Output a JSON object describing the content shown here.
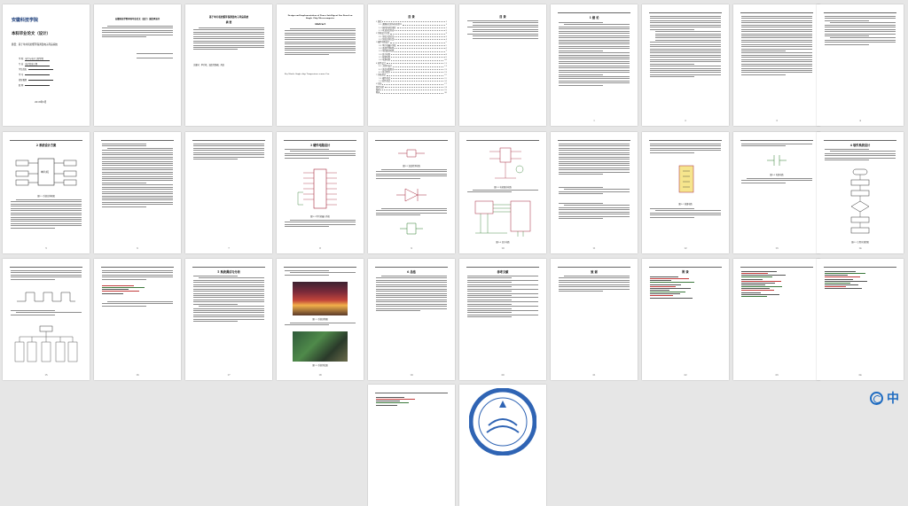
{
  "viewer": {
    "mode": "multi-page thumbnail view",
    "page_count": 42
  },
  "cover": {
    "school_name": "安徽科技学院",
    "thesis_type": "本科毕业论文（设计）",
    "topic_label": "题目：",
    "topic": "基于单片机的聚环保调温电子风扇系统",
    "fields": [
      {
        "label": "学  院",
        "value": "电气与电子工程学院"
      },
      {
        "label": "专  业",
        "value": "电子信息工程"
      },
      {
        "label": "学生姓名",
        "value": ""
      },
      {
        "label": "学  号",
        "value": ""
      },
      {
        "label": "指导教师",
        "value": ""
      },
      {
        "label": "职  称",
        "value": ""
      }
    ],
    "date": "2018年5月"
  },
  "declaration": {
    "title": "安徽科技学院本科毕业论文（设计）诚信承诺书"
  },
  "abstract_cn": {
    "title": "基于单片机的聚环保调温电子风扇系统",
    "subtitle": "摘  要",
    "keywords": "关键词：单片机；温度传感器；风扇"
  },
  "abstract_en": {
    "title": "Design and Implementation of Power Intelligent Fan Based on Single Chip Microcomputer",
    "subtitle": "Abstract",
    "keywords": "Key Words: Single chip; Temperature sensor; Fan"
  },
  "toc": {
    "title": "目  录",
    "entries": [
      "1 绪论",
      "1.1 课题研究的背景和意义",
      "1.2 国内外研究现状",
      "1.3 本文研究内容",
      "2 系统设计方案",
      "2.1 系统方案论证",
      "2.2 系统总体方案",
      "3 硬件电路设计",
      "3.1 单片机最小系统",
      "3.2 温度检测电路",
      "3.3 电机驱动电路",
      "3.4 显示电路",
      "3.5 按键电路",
      "3.6 电源电路",
      "4 软件设计",
      "4.1 主程序设计",
      "4.2 温度采集程序",
      "4.3 显示程序",
      "5 系统调试",
      "5.1 硬件调试",
      "5.2 软件调试",
      "6 总结",
      "参考文献",
      "致谢",
      "附录"
    ],
    "pages": [
      "1",
      "1",
      "1",
      "2",
      "3",
      "3",
      "4",
      "5",
      "5",
      "6",
      "7",
      "8",
      "9",
      "10",
      "11",
      "11",
      "12",
      "13",
      "15",
      "15",
      "16",
      "17",
      "18",
      "19",
      "20"
    ]
  },
  "sections": {
    "toc2": "目  录",
    "ch1": "1 绪  论",
    "ch2": "2 系统设计方案",
    "ch3": "3 硬件电路设计",
    "ch4": "4 软件系统设计",
    "ch5": "5 系统调试与分析",
    "summary": "6 总结",
    "refs": "参考文献",
    "thanks": "致  谢",
    "appendix": "附  录"
  },
  "figures": {
    "fig_block": "图2-1 系统总体框图",
    "fig_mcu": "图3-1 单片机最小系统",
    "fig_temp": "图3-2 温度检测电路",
    "fig_motor": "图3-3 电机驱动电路",
    "fig_display": "图3-4 显示电路",
    "fig_key": "图3-5 按键电路",
    "fig_flow": "图4-1 主程序流程图",
    "fig_photo1": "图5-1 系统实物图",
    "fig_photo2": "图5-2 系统测试图"
  },
  "badge": {
    "text": "中"
  },
  "colors": {
    "background": "#e6e6e6",
    "page": "#ffffff",
    "badge": "#1f6cc1",
    "emblem": "#2f64b4"
  }
}
